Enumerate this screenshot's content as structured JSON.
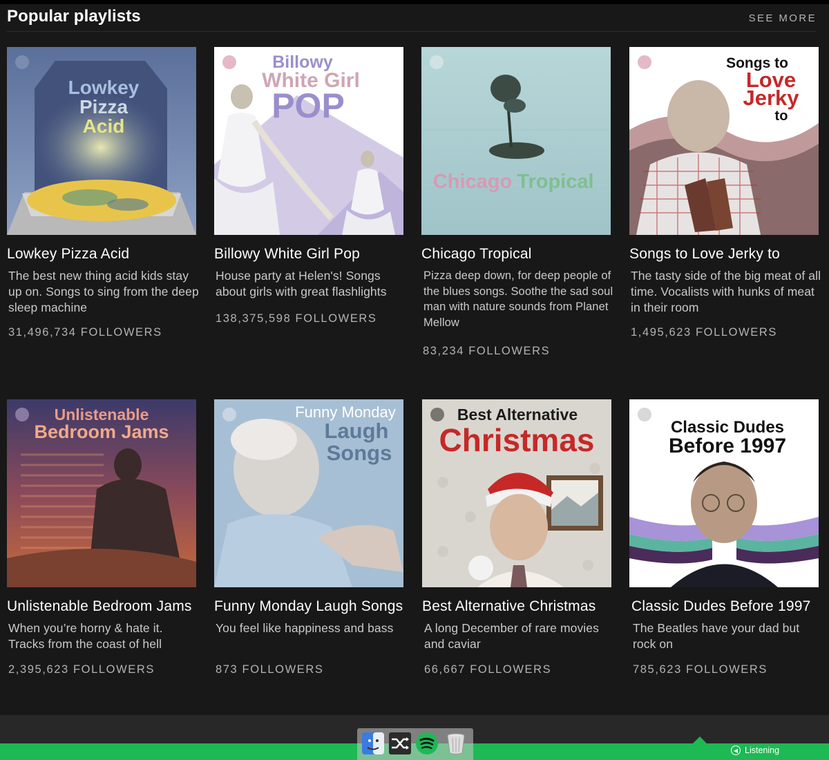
{
  "section": {
    "title": "Popular playlists",
    "see_more": "SEE MORE"
  },
  "playlists": [
    {
      "title": "Lowkey Pizza Acid",
      "description": "The best new thing acid kids stay up on. Songs to sing from the deep sleep machine",
      "followers": "31,496,734 FOLLOWERS",
      "cover_text": [
        "Lowkey",
        "Pizza",
        "Acid"
      ]
    },
    {
      "title": "Billowy White Girl Pop",
      "description": "House party at Helen's! Songs about girls with great flashlights",
      "followers": "138,375,598 FOLLOWERS",
      "cover_text": [
        "Billowy",
        "White Girl",
        "POP"
      ]
    },
    {
      "title": "Chicago Tropical",
      "description": "Pizza deep down, for deep people of the blues songs. Soothe the sad soul man with nature sounds from Planet Mellow",
      "followers": "83,234 FOLLOWERS",
      "cover_text": [
        "Chicago",
        "Tropical"
      ]
    },
    {
      "title": "Songs to Love Jerky to",
      "description": "The tasty side of the big meat of all time. Vocalists with hunks of meat in their room",
      "followers": "1,495,623 FOLLOWERS",
      "cover_text": [
        "Songs to",
        "Love",
        "Jerky",
        "to"
      ]
    },
    {
      "title": "Unlistenable Bedroom Jams",
      "description": "When you’re horny & hate it. Tracks from the coast of hell",
      "followers": "2,395,623 FOLLOWERS",
      "cover_text": [
        "Unlistenable",
        "Bedroom Jams"
      ]
    },
    {
      "title": "Funny Monday Laugh Songs",
      "description": "You feel like happiness and bass",
      "followers": "873 FOLLOWERS",
      "cover_text": [
        "Funny Monday",
        "Laugh",
        "Songs"
      ]
    },
    {
      "title": "Best Alternative Christmas",
      "description": "A long December of rare movies and caviar",
      "followers": "66,667 FOLLOWERS",
      "cover_text": [
        "Best Alternative",
        "Christmas"
      ]
    },
    {
      "title": "Classic Dudes Before 1997",
      "description": "The Beatles have your dad but rock on",
      "followers": "785,623 FOLLOWERS",
      "cover_text": [
        "Classic Dudes",
        "Before 1997"
      ]
    }
  ],
  "status_bar": {
    "listening": "Listening"
  },
  "dock": [
    "finder-icon",
    "shuffle-icon",
    "spotify-icon",
    "trash-icon"
  ],
  "colors": {
    "accent": "#1db954",
    "background": "#181818"
  }
}
